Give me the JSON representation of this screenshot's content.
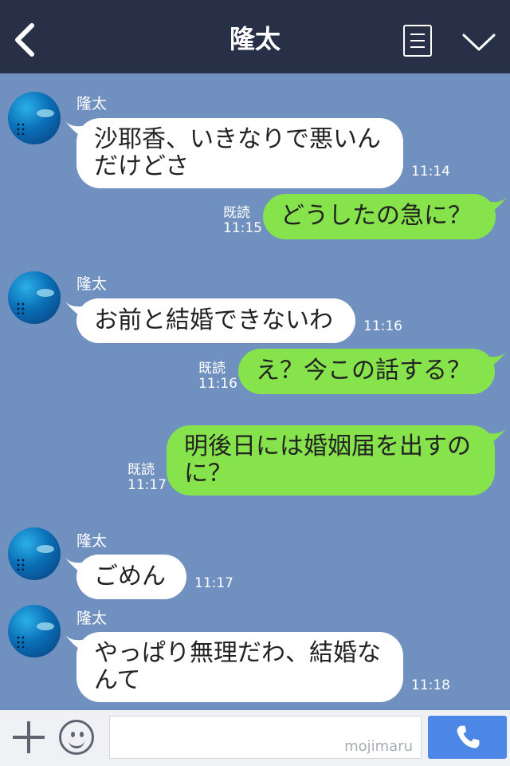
{
  "header": {
    "title": "隆太",
    "back_icon": "chevron-left-icon",
    "menu_icon": "list-icon",
    "dropdown_icon": "chevron-down-icon",
    "background": "#273046"
  },
  "chat_background": "#7090c0",
  "messages": [
    {
      "from": "friend",
      "sender": "隆太",
      "lines": [
        "沙耶香、いきなりで悪いん",
        "だけどさ"
      ],
      "time": "11:14"
    },
    {
      "from": "me",
      "read": "既読",
      "lines": [
        "どうしたの急に？"
      ],
      "time": "11:15"
    },
    {
      "from": "friend",
      "sender": "隆太",
      "lines": [
        "お前と結婚できないわ"
      ],
      "time": "11:16"
    },
    {
      "from": "me",
      "read": "既読",
      "lines": [
        "え？今この話する？"
      ],
      "time": "11:16"
    },
    {
      "from": "me",
      "read": "既読",
      "lines": [
        "明後日には婚姻届を出すの",
        "に？"
      ],
      "time": "11:17"
    },
    {
      "from": "friend",
      "sender": "隆太",
      "lines": [
        "ごめん"
      ],
      "time": "11:17"
    },
    {
      "from": "friend",
      "sender": "隆太",
      "lines": [
        "やっぱり無理だわ、結婚な",
        "んて"
      ],
      "time": "11:18"
    }
  ],
  "input_bar": {
    "watermark": "mojimaru",
    "plus_icon": "plus-icon",
    "emoji_icon": "smiley-icon",
    "call_icon": "phone-icon",
    "call_color": "#4c86e6"
  },
  "colors": {
    "my_bubble": "#86e34b",
    "friend_bubble": "#ffffff"
  }
}
